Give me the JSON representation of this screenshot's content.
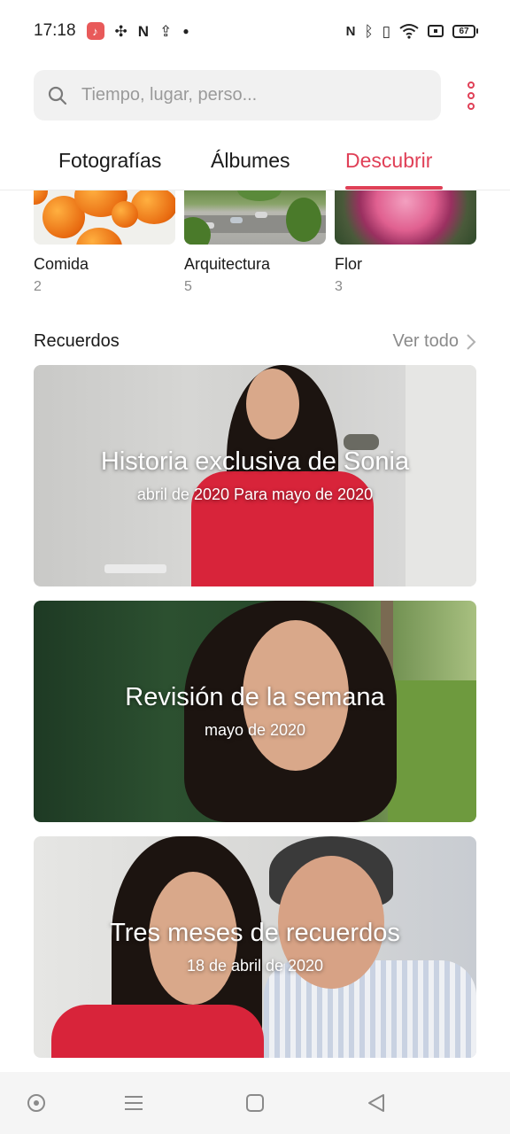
{
  "status_bar": {
    "time": "17:18",
    "battery": "67"
  },
  "search": {
    "placeholder": "Tiempo, lugar, perso..."
  },
  "tabs": [
    {
      "label": "Fotografías",
      "active": false
    },
    {
      "label": "Álbumes",
      "active": false
    },
    {
      "label": "Descubrir",
      "active": true
    }
  ],
  "accent_color": "#e04057",
  "categories": [
    {
      "name": "Comida",
      "count": "2"
    },
    {
      "name": "Arquitectura",
      "count": "5"
    },
    {
      "name": "Flor",
      "count": "3"
    }
  ],
  "memories": {
    "title": "Recuerdos",
    "view_all": "Ver todo",
    "cards": [
      {
        "title": "Historia exclusiva de Sonia",
        "subtitle": "abril de 2020 Para mayo de 2020"
      },
      {
        "title": "Revisión de la semana",
        "subtitle": "mayo de 2020"
      },
      {
        "title": "Tres meses de recuerdos",
        "subtitle": "18 de abril de 2020"
      }
    ]
  },
  "nav_bar": {
    "icons": [
      "circle-dot-icon",
      "menu-icon",
      "square-icon",
      "back-triangle-icon"
    ]
  }
}
